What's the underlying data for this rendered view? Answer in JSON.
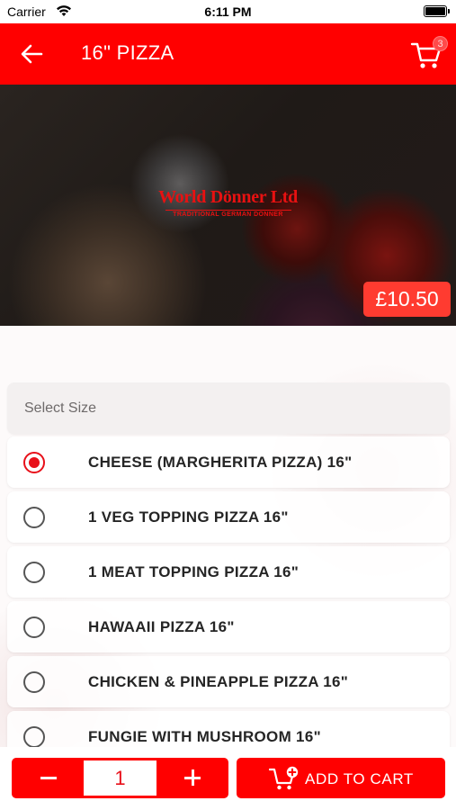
{
  "status_bar": {
    "carrier": "Carrier",
    "time": "6:11 PM"
  },
  "header": {
    "title": "16\" PIZZA",
    "cart_count": "3"
  },
  "hero": {
    "brand_name": "World Dönner Ltd",
    "brand_tagline": "TRADITIONAL GERMAN DONNER",
    "price": "£10.50"
  },
  "size_section": {
    "header": "Select Size",
    "options": [
      {
        "label": "CHEESE (MARGHERITA PIZZA) 16\"",
        "selected": true
      },
      {
        "label": "1 VEG TOPPING PIZZA 16\"",
        "selected": false
      },
      {
        "label": "1 MEAT TOPPING PIZZA 16\"",
        "selected": false
      },
      {
        "label": "HAWAAII PIZZA 16\"",
        "selected": false
      },
      {
        "label": "CHICKEN & PINEAPPLE PIZZA 16\"",
        "selected": false
      },
      {
        "label": "FUNGIE WITH MUSHROOM 16\"",
        "selected": false
      }
    ]
  },
  "bottom_bar": {
    "quantity": "1",
    "add_to_cart_label": "ADD TO CART"
  },
  "colors": {
    "brand_red": "#ff0000",
    "price_badge": "#ff3b30",
    "radio_selected": "#e8101a"
  }
}
